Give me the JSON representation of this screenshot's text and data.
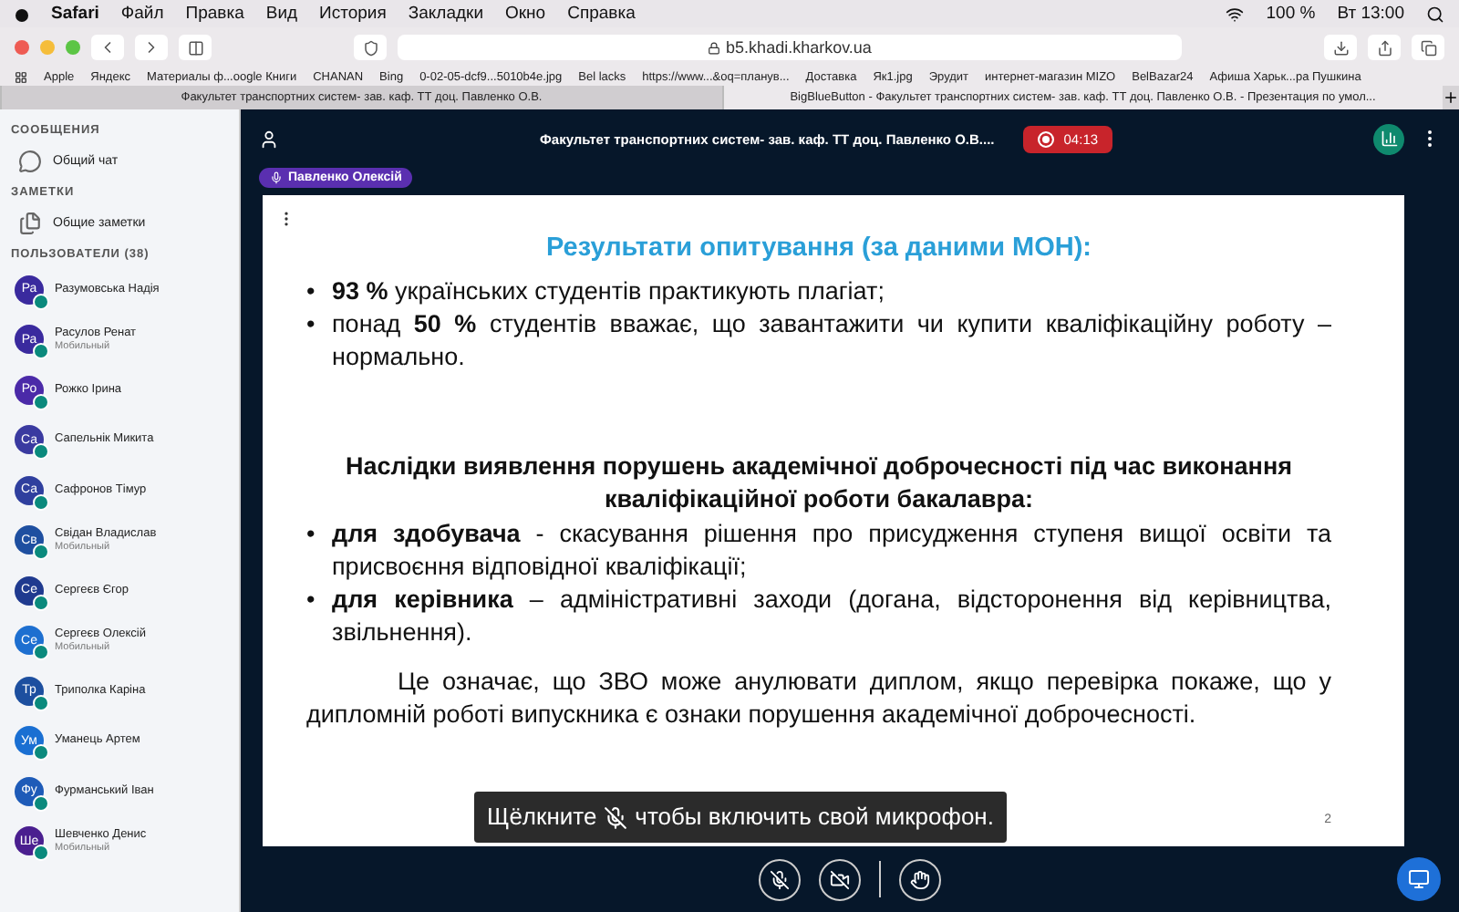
{
  "menubar": {
    "app": "Safari",
    "items": [
      "Файл",
      "Правка",
      "Вид",
      "История",
      "Закладки",
      "Окно",
      "Справка"
    ],
    "battery": "100 %",
    "clock": "Вт 13:00"
  },
  "toolbar": {
    "url": "b5.khadi.kharkov.ua"
  },
  "bookmarks": [
    "Apple",
    "Яндекс",
    "Материалы ф...oogle Книги",
    "CHANAN",
    "Bing",
    "0-02-05-dcf9...5010b4e.jpg",
    "Bel lacks",
    "https://www...&oq=планув...",
    "Доставка",
    "Як1.jpg",
    "Эрудит",
    "интернет-магазин MIZO",
    "BelBazar24",
    "Афиша Харьк...ра Пушкина"
  ],
  "tabs": [
    {
      "title": "Факультет транспортних систем- зав. каф. ТТ доц. Павленко О.В.",
      "selected": false
    },
    {
      "title": "BigBlueButton - Факультет транспортних систем- зав. каф. ТТ доц. Павленко О.В. - Презентация по умол...",
      "selected": true
    }
  ],
  "sidebar": {
    "messages_heading": "СООБЩЕНИЯ",
    "chat": "Общий чат",
    "notes_heading": "ЗАМЕТКИ",
    "notes": "Общие заметки",
    "users_heading": "ПОЛЬЗОВАТЕЛИ (38)",
    "users": [
      {
        "initials": "Ра",
        "name": "Разумовська Надія",
        "color": "#3a2a9e"
      },
      {
        "initials": "Ра",
        "name": "Расулов Ренат",
        "device": "Мобильный",
        "color": "#3a2a9e"
      },
      {
        "initials": "Ро",
        "name": "Рожко Ірина",
        "color": "#4b2aa8"
      },
      {
        "initials": "Са",
        "name": "Сапельнік Микита",
        "color": "#3a3aa0"
      },
      {
        "initials": "Са",
        "name": "Сафронов Тімур",
        "color": "#2f3f9e"
      },
      {
        "initials": "Св",
        "name": "Свідан Владислав",
        "device": "Мобильный",
        "color": "#1e4fa0"
      },
      {
        "initials": "Се",
        "name": "Сергеєв Єгор",
        "color": "#1f3a8f"
      },
      {
        "initials": "Се",
        "name": "Сергеєв Олексій",
        "device": "Мобильный",
        "color": "#1d6fd0"
      },
      {
        "initials": "Тр",
        "name": "Триполка Каріна",
        "color": "#1d4f9f"
      },
      {
        "initials": "Ум",
        "name": "Уманець Артем",
        "color": "#1a6fd2"
      },
      {
        "initials": "Фу",
        "name": "Фурманський Іван",
        "color": "#1e5bb8"
      },
      {
        "initials": "Ше",
        "name": "Шевченко Денис",
        "device": "Мобильный",
        "color": "#4a1f8f"
      }
    ]
  },
  "meeting": {
    "title": "Факультет транспортних систем- зав. каф. ТТ доц. Павленко О.В....",
    "timer": "04:13",
    "recording": true,
    "presenter": "Павленко Олексій"
  },
  "slide": {
    "title": "Результати опитування (за даними МОН):",
    "bullets_1": [
      "**93 %** українських студентів практикують плагіат;",
      "понад **50 %** студентів вважає, що завантажити чи купити кваліфікаційну роботу – нормально."
    ],
    "heading": "Наслідки виявлення порушень академічної доброчесності під час виконання кваліфікаційної роботи бакалавра:",
    "bullets_2": [
      "**для здобувача** - скасування рішення про присудження ступеня вищої освіти та присвоєння відповідної кваліфікації;",
      "**для керівника** – адміністративні заходи (догана, відсторонення від керівництва, звільнення)."
    ],
    "conclusion": "Це означає, що ЗВО може анулювати диплом, якщо перевірка покаже, що у дипломній роботі випускника є ознаки порушення академічної доброчесності.",
    "bullet": "•",
    "page": "2"
  },
  "toast": {
    "before": "Щёлкните",
    "after": "чтобы включить свой микрофон."
  }
}
